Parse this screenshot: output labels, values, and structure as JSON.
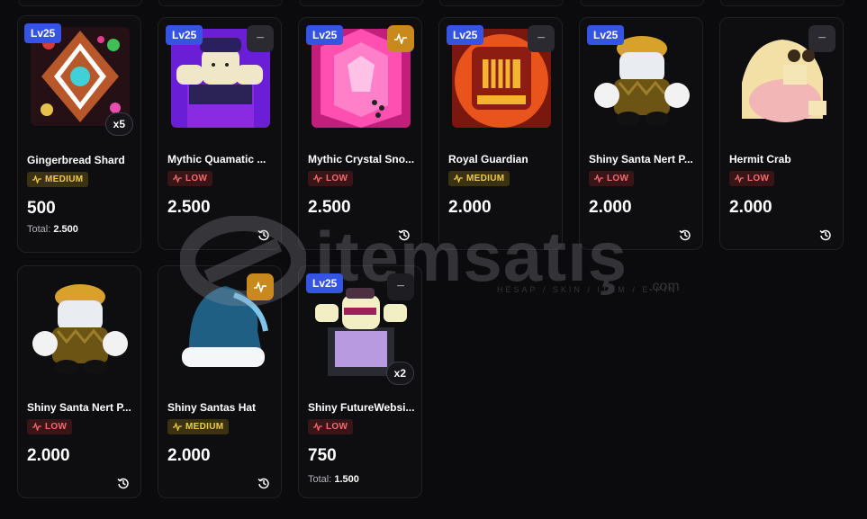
{
  "watermark": {
    "brand": "itemsatış",
    "tagline": "HESAP / SKIN / ITEM / E-PIN",
    "suffix": ".com"
  },
  "items": [
    {
      "level": "Lv25",
      "name": "Gingerbread Shard",
      "demand": "MEDIUM",
      "price": "500",
      "total_label": "Total:",
      "total": "2.500",
      "qty": "x5",
      "corner": "none"
    },
    {
      "level": "Lv25",
      "name": "Mythic Quamatic ...",
      "demand": "LOW",
      "price": "2.500",
      "corner": "dash"
    },
    {
      "level": "Lv25",
      "name": "Mythic Crystal Sno...",
      "demand": "LOW",
      "price": "2.500",
      "corner": "pulse"
    },
    {
      "level": "Lv25",
      "name": "Royal Guardian",
      "demand": "MEDIUM",
      "price": "2.000",
      "corner": "dash"
    },
    {
      "level": "Lv25",
      "name": "Shiny Santa Nert P...",
      "demand": "LOW",
      "price": "2.000",
      "corner": "none"
    },
    {
      "level": "",
      "name": "Hermit Crab",
      "demand": "LOW",
      "price": "2.000",
      "corner": "dash"
    },
    {
      "level": "",
      "name": "Shiny Santa Nert P...",
      "demand": "LOW",
      "price": "2.000",
      "corner": "none"
    },
    {
      "level": "",
      "name": "Shiny Santas Hat",
      "demand": "MEDIUM",
      "price": "2.000",
      "corner": "pulse"
    },
    {
      "level": "Lv25",
      "name": "Shiny FutureWebsi...",
      "demand": "LOW",
      "price": "750",
      "total_label": "Total:",
      "total": "1.500",
      "qty": "x2",
      "corner": "dash"
    }
  ]
}
